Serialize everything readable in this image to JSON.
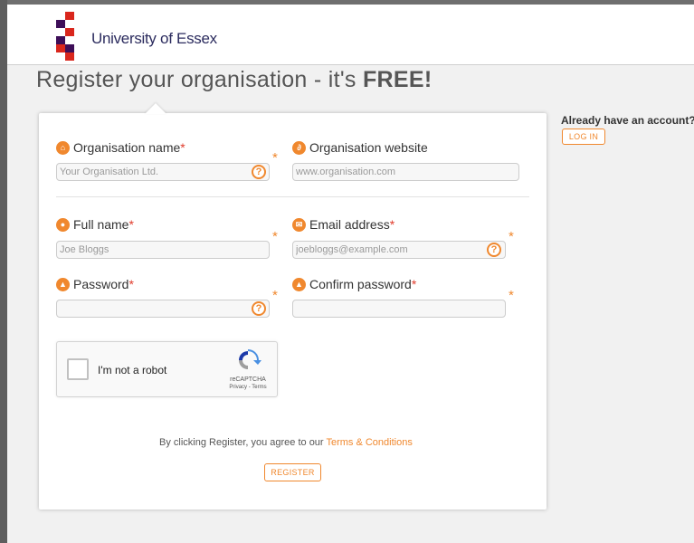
{
  "brand": {
    "name": "University of Essex",
    "logo_colors": {
      "red": "#d9261c",
      "purple": "#3d0e58"
    }
  },
  "page": {
    "title_prefix": "Register your organisation - it's ",
    "title_emphasis": "FREE!"
  },
  "form": {
    "org_name": {
      "label": "Organisation name",
      "required_mark": "*",
      "placeholder": "Your Organisation Ltd.",
      "icon": "home-icon"
    },
    "org_website": {
      "label": "Organisation website",
      "placeholder": "www.organisation.com",
      "icon": "link-icon"
    },
    "full_name": {
      "label": "Full name",
      "required_mark": "*",
      "placeholder": "Joe Bloggs",
      "icon": "user-icon"
    },
    "email": {
      "label": "Email address",
      "required_mark": "*",
      "placeholder": "joebloggs@example.com",
      "icon": "envelope-icon"
    },
    "password": {
      "label": "Password",
      "required_mark": "*",
      "placeholder": "",
      "icon": "lock-icon"
    },
    "confirm_password": {
      "label": "Confirm password",
      "required_mark": "*",
      "placeholder": "",
      "icon": "lock-icon"
    },
    "help_glyph": "?",
    "side_star": "*"
  },
  "captcha": {
    "label": "I'm not a robot",
    "brand": "reCAPTCHA",
    "links": "Privacy - Terms"
  },
  "agreement": {
    "text": "By clicking Register, you agree to our ",
    "link": "Terms & Conditions"
  },
  "actions": {
    "register": "REGISTER",
    "login": "LOG IN",
    "have_account": "Already have an account?"
  },
  "colors": {
    "accent": "#f0882e",
    "required": "#e03b2b"
  }
}
